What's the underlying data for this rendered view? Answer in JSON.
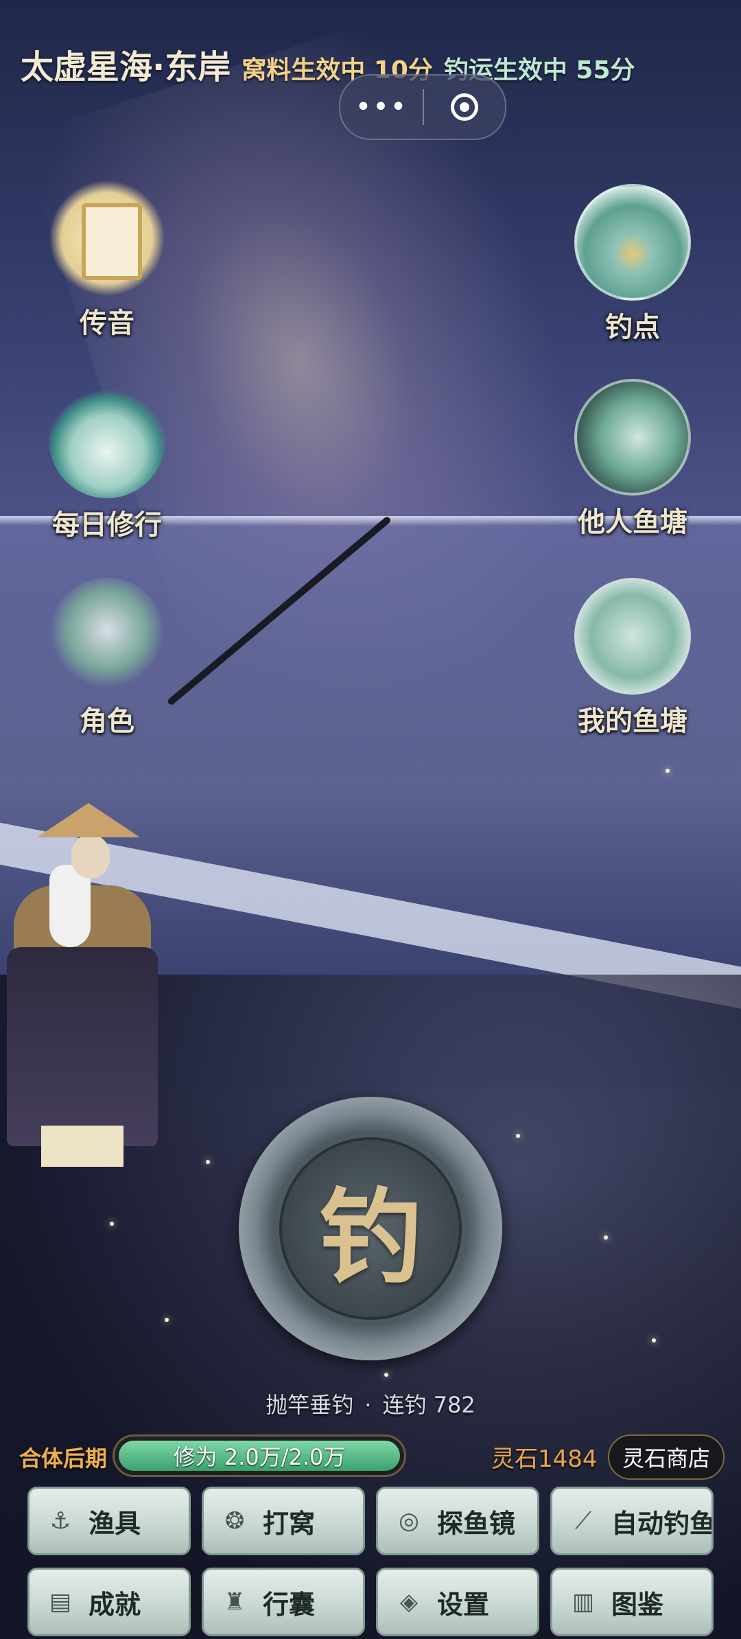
{
  "header": {
    "location": "太虚星海·东岸",
    "bait_buff": "窝料生效中 10分",
    "luck_buff": "钓运生效中 55分"
  },
  "capsule": {
    "more_glyph": "•••",
    "close_glyph": "◉"
  },
  "left_menu": [
    {
      "label": "传音",
      "icon": "scroll-bell-icon"
    },
    {
      "label": "每日修行",
      "icon": "mountain-incense-icon"
    },
    {
      "label": "角色",
      "icon": "character-portrait-icon"
    }
  ],
  "right_menu": [
    {
      "label": "钓点",
      "icon": "fishing-spot-icon"
    },
    {
      "label": "他人鱼塘",
      "icon": "others-pond-icon"
    },
    {
      "label": "我的鱼塘",
      "icon": "my-pond-icon"
    }
  ],
  "fish_button": {
    "char": "钓"
  },
  "fish_status": {
    "action": "抛竿垂钓",
    "separator": "·",
    "streak": "连钓 782"
  },
  "player": {
    "realm": "合体后期",
    "cultivation_text": "修为 2.0万/2.0万",
    "cultivation_progress": 1.0,
    "spirit_stone": "灵石1484",
    "shop_label": "灵石商店"
  },
  "grid": [
    {
      "label": "渔具",
      "icon": "hook-icon",
      "glyph": "⚓"
    },
    {
      "label": "打窝",
      "icon": "bait-pot-icon",
      "glyph": "❂"
    },
    {
      "label": "探鱼镜",
      "icon": "mirror-icon",
      "glyph": "◎"
    },
    {
      "label": "自动钓鱼",
      "icon": "rod-icon",
      "glyph": "⟋"
    },
    {
      "label": "成就",
      "icon": "book-icon",
      "glyph": "▤"
    },
    {
      "label": "行囊",
      "icon": "cauldron-icon",
      "glyph": "♜"
    },
    {
      "label": "设置",
      "icon": "coin-settings-icon",
      "glyph": "◈"
    },
    {
      "label": "图鉴",
      "icon": "codex-icon",
      "glyph": "▥"
    }
  ],
  "colors": {
    "realm": "#f0b04a",
    "xp_fill": "#3aa26d",
    "stone": "#e9a64b",
    "fish_char": "#d9c28f"
  }
}
